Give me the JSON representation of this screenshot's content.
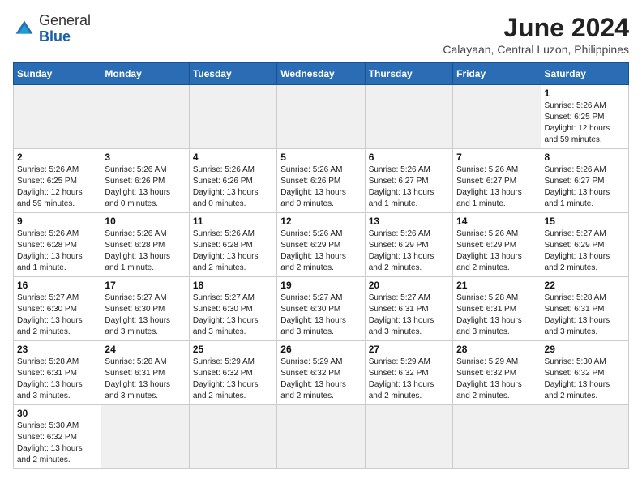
{
  "header": {
    "logo": {
      "general": "General",
      "blue": "Blue"
    },
    "title": "June 2024",
    "location": "Calayaan, Central Luzon, Philippines"
  },
  "days_of_week": [
    "Sunday",
    "Monday",
    "Tuesday",
    "Wednesday",
    "Thursday",
    "Friday",
    "Saturday"
  ],
  "weeks": [
    [
      {
        "day": "",
        "empty": true
      },
      {
        "day": "",
        "empty": true
      },
      {
        "day": "",
        "empty": true
      },
      {
        "day": "",
        "empty": true
      },
      {
        "day": "",
        "empty": true
      },
      {
        "day": "",
        "empty": true
      },
      {
        "day": "1",
        "info": "Sunrise: 5:26 AM\nSunset: 6:25 PM\nDaylight: 12 hours\nand 59 minutes."
      }
    ],
    [
      {
        "day": "2",
        "info": "Sunrise: 5:26 AM\nSunset: 6:25 PM\nDaylight: 12 hours\nand 59 minutes."
      },
      {
        "day": "3",
        "info": "Sunrise: 5:26 AM\nSunset: 6:26 PM\nDaylight: 13 hours\nand 0 minutes."
      },
      {
        "day": "4",
        "info": "Sunrise: 5:26 AM\nSunset: 6:26 PM\nDaylight: 13 hours\nand 0 minutes."
      },
      {
        "day": "5",
        "info": "Sunrise: 5:26 AM\nSunset: 6:26 PM\nDaylight: 13 hours\nand 0 minutes."
      },
      {
        "day": "6",
        "info": "Sunrise: 5:26 AM\nSunset: 6:27 PM\nDaylight: 13 hours\nand 1 minute."
      },
      {
        "day": "7",
        "info": "Sunrise: 5:26 AM\nSunset: 6:27 PM\nDaylight: 13 hours\nand 1 minute."
      },
      {
        "day": "8",
        "info": "Sunrise: 5:26 AM\nSunset: 6:27 PM\nDaylight: 13 hours\nand 1 minute."
      }
    ],
    [
      {
        "day": "9",
        "info": "Sunrise: 5:26 AM\nSunset: 6:28 PM\nDaylight: 13 hours\nand 1 minute."
      },
      {
        "day": "10",
        "info": "Sunrise: 5:26 AM\nSunset: 6:28 PM\nDaylight: 13 hours\nand 1 minute."
      },
      {
        "day": "11",
        "info": "Sunrise: 5:26 AM\nSunset: 6:28 PM\nDaylight: 13 hours\nand 2 minutes."
      },
      {
        "day": "12",
        "info": "Sunrise: 5:26 AM\nSunset: 6:29 PM\nDaylight: 13 hours\nand 2 minutes."
      },
      {
        "day": "13",
        "info": "Sunrise: 5:26 AM\nSunset: 6:29 PM\nDaylight: 13 hours\nand 2 minutes."
      },
      {
        "day": "14",
        "info": "Sunrise: 5:26 AM\nSunset: 6:29 PM\nDaylight: 13 hours\nand 2 minutes."
      },
      {
        "day": "15",
        "info": "Sunrise: 5:27 AM\nSunset: 6:29 PM\nDaylight: 13 hours\nand 2 minutes."
      }
    ],
    [
      {
        "day": "16",
        "info": "Sunrise: 5:27 AM\nSunset: 6:30 PM\nDaylight: 13 hours\nand 2 minutes."
      },
      {
        "day": "17",
        "info": "Sunrise: 5:27 AM\nSunset: 6:30 PM\nDaylight: 13 hours\nand 3 minutes."
      },
      {
        "day": "18",
        "info": "Sunrise: 5:27 AM\nSunset: 6:30 PM\nDaylight: 13 hours\nand 3 minutes."
      },
      {
        "day": "19",
        "info": "Sunrise: 5:27 AM\nSunset: 6:30 PM\nDaylight: 13 hours\nand 3 minutes."
      },
      {
        "day": "20",
        "info": "Sunrise: 5:27 AM\nSunset: 6:31 PM\nDaylight: 13 hours\nand 3 minutes."
      },
      {
        "day": "21",
        "info": "Sunrise: 5:28 AM\nSunset: 6:31 PM\nDaylight: 13 hours\nand 3 minutes."
      },
      {
        "day": "22",
        "info": "Sunrise: 5:28 AM\nSunset: 6:31 PM\nDaylight: 13 hours\nand 3 minutes."
      }
    ],
    [
      {
        "day": "23",
        "info": "Sunrise: 5:28 AM\nSunset: 6:31 PM\nDaylight: 13 hours\nand 3 minutes."
      },
      {
        "day": "24",
        "info": "Sunrise: 5:28 AM\nSunset: 6:31 PM\nDaylight: 13 hours\nand 3 minutes."
      },
      {
        "day": "25",
        "info": "Sunrise: 5:29 AM\nSunset: 6:32 PM\nDaylight: 13 hours\nand 2 minutes."
      },
      {
        "day": "26",
        "info": "Sunrise: 5:29 AM\nSunset: 6:32 PM\nDaylight: 13 hours\nand 2 minutes."
      },
      {
        "day": "27",
        "info": "Sunrise: 5:29 AM\nSunset: 6:32 PM\nDaylight: 13 hours\nand 2 minutes."
      },
      {
        "day": "28",
        "info": "Sunrise: 5:29 AM\nSunset: 6:32 PM\nDaylight: 13 hours\nand 2 minutes."
      },
      {
        "day": "29",
        "info": "Sunrise: 5:30 AM\nSunset: 6:32 PM\nDaylight: 13 hours\nand 2 minutes."
      }
    ],
    [
      {
        "day": "30",
        "info": "Sunrise: 5:30 AM\nSunset: 6:32 PM\nDaylight: 13 hours\nand 2 minutes."
      },
      {
        "day": "",
        "empty": true
      },
      {
        "day": "",
        "empty": true
      },
      {
        "day": "",
        "empty": true
      },
      {
        "day": "",
        "empty": true
      },
      {
        "day": "",
        "empty": true
      },
      {
        "day": "",
        "empty": true
      }
    ]
  ]
}
